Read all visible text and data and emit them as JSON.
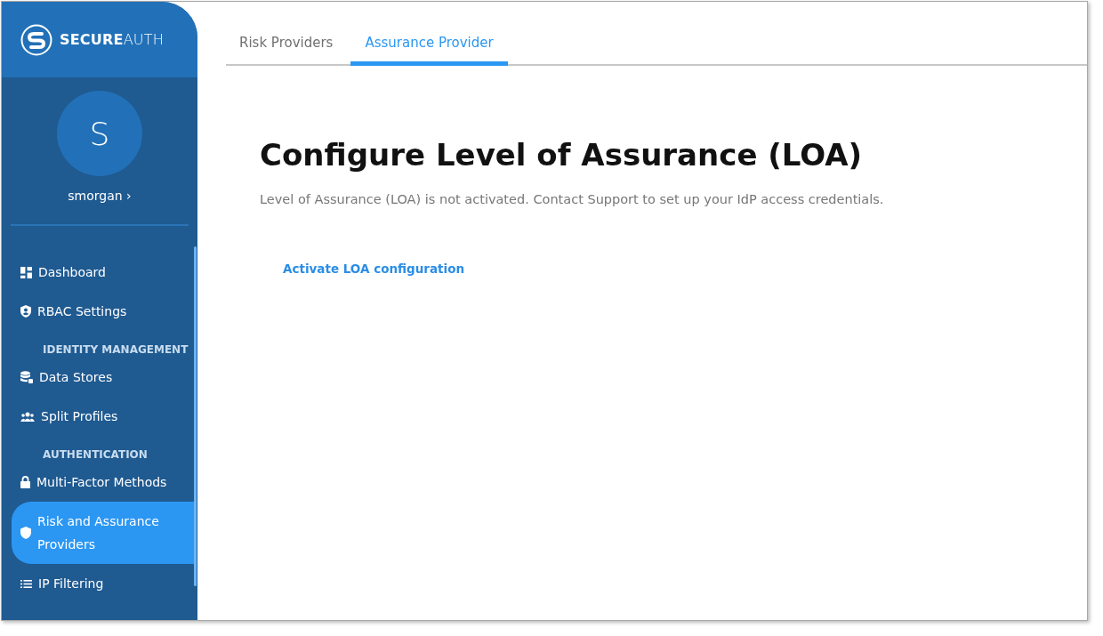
{
  "logo": {
    "text": "**SECURE**AUTH"
  },
  "user": {
    "initial": "S",
    "name": "smorgan",
    "chevron": "›"
  },
  "nav": [
    {
      "kind": "item",
      "label": "Dashboard",
      "selected": false
    },
    {
      "kind": "item",
      "label": "RBAC Settings",
      "selected": false
    },
    {
      "kind": "section",
      "label": "IDENTITY MANAGEMENT"
    },
    {
      "kind": "item",
      "label": "Data Stores",
      "selected": false
    },
    {
      "kind": "item",
      "label": "Split Profiles",
      "selected": false
    },
    {
      "kind": "section",
      "label": "AUTHENTICATION"
    },
    {
      "kind": "item",
      "label": "Multi-Factor Methods",
      "selected": false
    },
    {
      "kind": "item",
      "label": "Risk and Assurance Providers",
      "selected": true
    },
    {
      "kind": "item",
      "label": "IP Filtering",
      "selected": false
    }
  ],
  "tabs": [
    {
      "label": "Risk Providers",
      "selected": false
    },
    {
      "label": "Assurance Provider",
      "selected": true
    }
  ],
  "heading": "Configure Level of Assurance (LOA)",
  "message": "Level of Assurance (LOA) is not activated. Contact Support to set up your IdP access credentials.",
  "action": "Activate LOA configuration"
}
